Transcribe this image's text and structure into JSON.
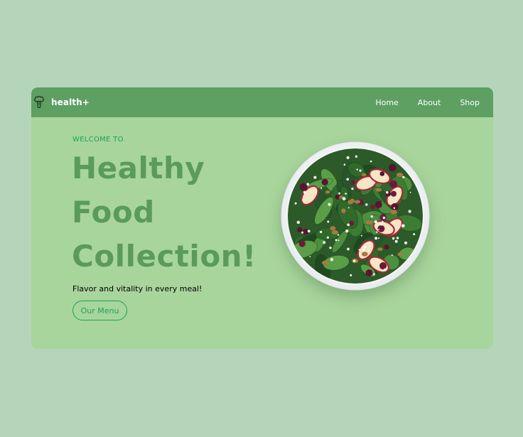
{
  "brand": {
    "name": "health+",
    "logo_icon": "broccoli-icon"
  },
  "nav": {
    "items": [
      {
        "label": "Home"
      },
      {
        "label": "About"
      },
      {
        "label": "Shop"
      }
    ]
  },
  "hero": {
    "eyebrow": "WELCOME TO",
    "headline_lines": [
      "Healthy",
      "Food",
      "Collection!"
    ],
    "tagline": "Flavor and vitality in every meal!",
    "cta_label": "Our Menu",
    "image": "salad-bowl-image"
  },
  "colors": {
    "page_background": "#b5d5ba",
    "card_background": "#a8d59c",
    "navbar": "#5da062",
    "headline": "#5a9b5b",
    "accent": "#1aa35a"
  }
}
